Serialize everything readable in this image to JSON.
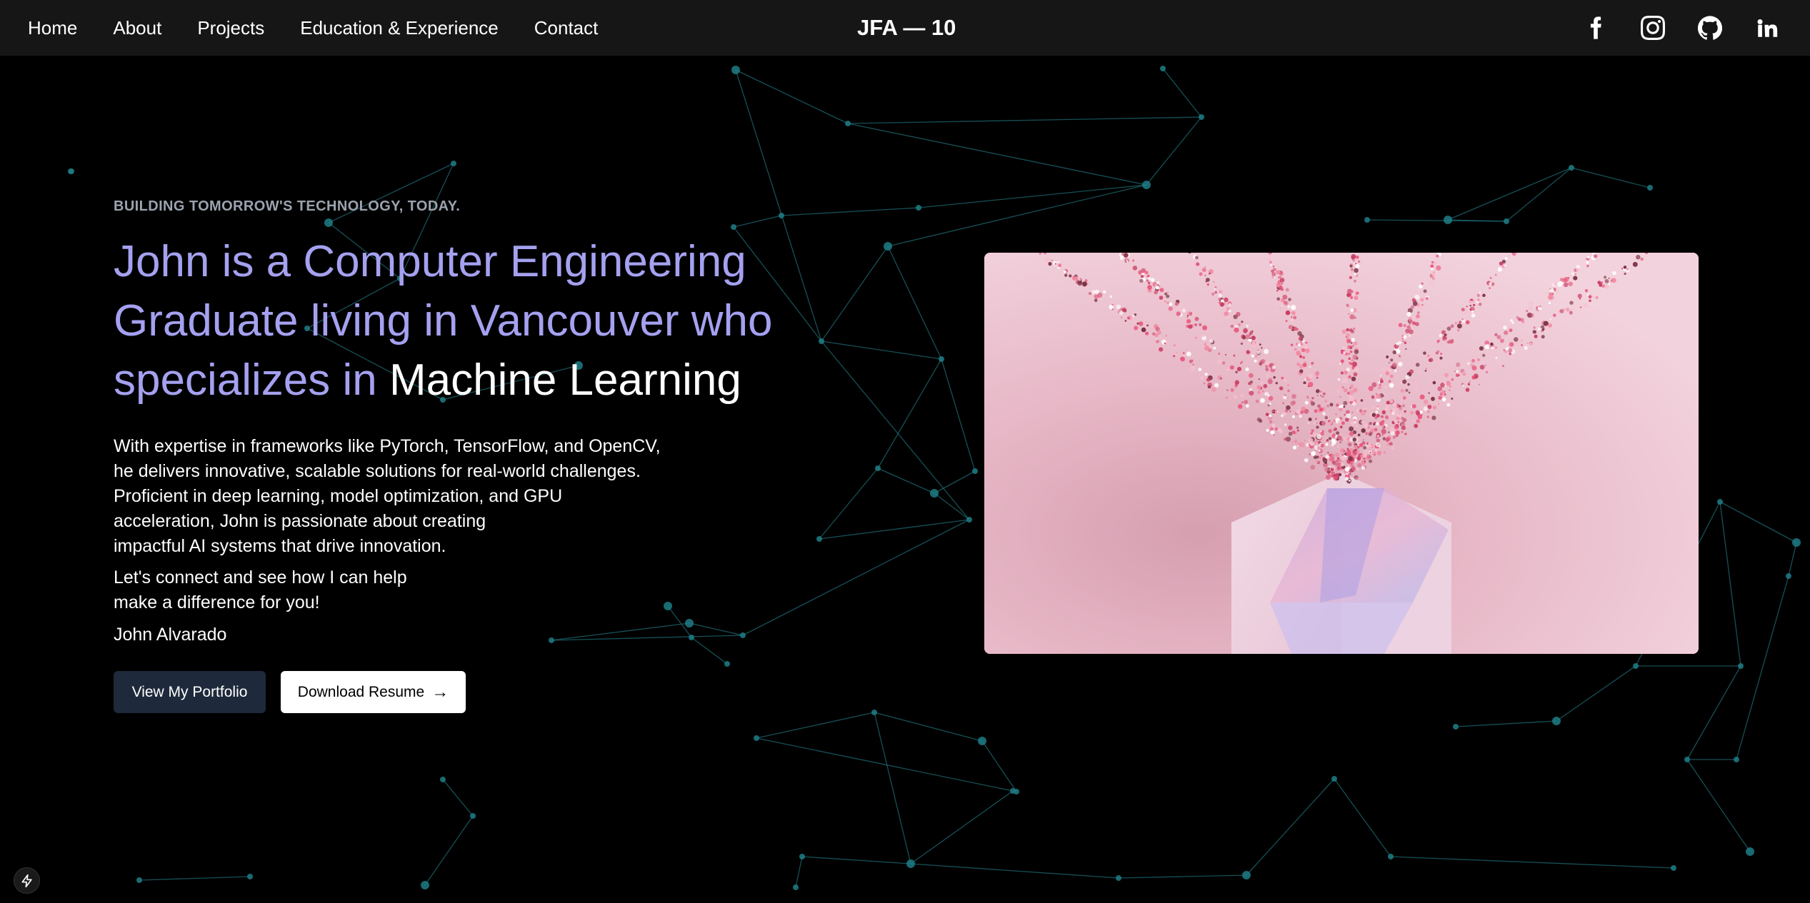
{
  "nav": {
    "links": [
      "Home",
      "About",
      "Projects",
      "Education & Experience",
      "Contact"
    ],
    "brand": "JFA — 10",
    "social_icons": [
      "facebook-icon",
      "instagram-icon",
      "github-icon",
      "linkedin-icon"
    ]
  },
  "hero": {
    "eyebrow": "BUILDING TOMORROW'S TECHNOLOGY, TODAY.",
    "headline_prefix": "John is a Computer Engineering Graduate living in Vancouver who specializes in",
    "headline_highlight": "Machine Learning",
    "description_lines": [
      "With expertise in frameworks like PyTorch, TensorFlow, and OpenCV,",
      "he delivers innovative, scalable solutions for real-world challenges.",
      "Proficient in deep learning, model optimization, and GPU",
      "acceleration, John is passionate about creating",
      "impactful AI systems that drive innovation."
    ],
    "cta_lines": [
      "Let's connect and see how I can help",
      "make a difference for you!"
    ],
    "signature": "John Alvarado",
    "primary_button": "View My Portfolio",
    "secondary_button": "Download Resume",
    "secondary_button_icon": "→"
  },
  "colors": {
    "background": "#000000",
    "navbar": "#161616",
    "headline_accent": "#a5a1f0",
    "network_line": "#1e6b73",
    "network_node": "#1f7c86",
    "primary_button": "#1e293b"
  }
}
